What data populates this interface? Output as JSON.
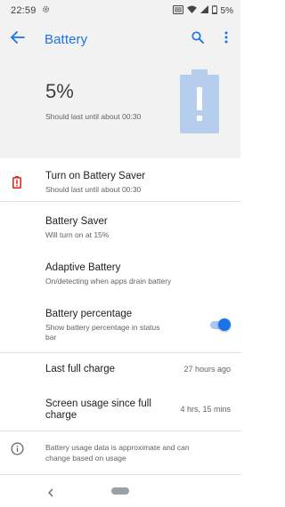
{
  "status_bar": {
    "time": "22:59",
    "battery_text": "5%",
    "icons": [
      "settings-gear-icon",
      "cast-icon",
      "wifi-icon",
      "signal-icon",
      "battery-icon"
    ]
  },
  "app_bar": {
    "title": "Battery",
    "accent_color": "#1a73e8",
    "icons": [
      "back-arrow-icon",
      "search-icon",
      "more-vert-icon"
    ]
  },
  "summary": {
    "percent": "5%",
    "estimate": "Should last until about 00:30",
    "battery_icon_color": "#b7cdee"
  },
  "items": {
    "turn_on_saver": {
      "title": "Turn on Battery Saver",
      "subtitle": "Should last until about 00:30",
      "icon": "battery-alert-icon",
      "icon_color": "#d93025"
    },
    "battery_saver": {
      "title": "Battery Saver",
      "subtitle": "Will turn on at 15%"
    },
    "adaptive_battery": {
      "title": "Adaptive Battery",
      "subtitle": "On/detecting when apps drain battery"
    },
    "battery_percentage": {
      "title": "Battery percentage",
      "subtitle_line1": "Show battery percentage in status",
      "subtitle_line2": "bar",
      "enabled": true
    },
    "last_full_charge": {
      "title": "Last full charge",
      "value": "27 hours ago"
    },
    "screen_usage": {
      "title_line1": "Screen usage since full",
      "title_line2": "charge",
      "value": "4 hrs, 15 mins"
    },
    "info_note": {
      "line1": "Battery usage data is approximate and can",
      "line2": "change based on usage",
      "icon": "info-icon"
    }
  },
  "nav_bar": {
    "icons": [
      "nav-back-icon",
      "home-pill-icon"
    ]
  }
}
